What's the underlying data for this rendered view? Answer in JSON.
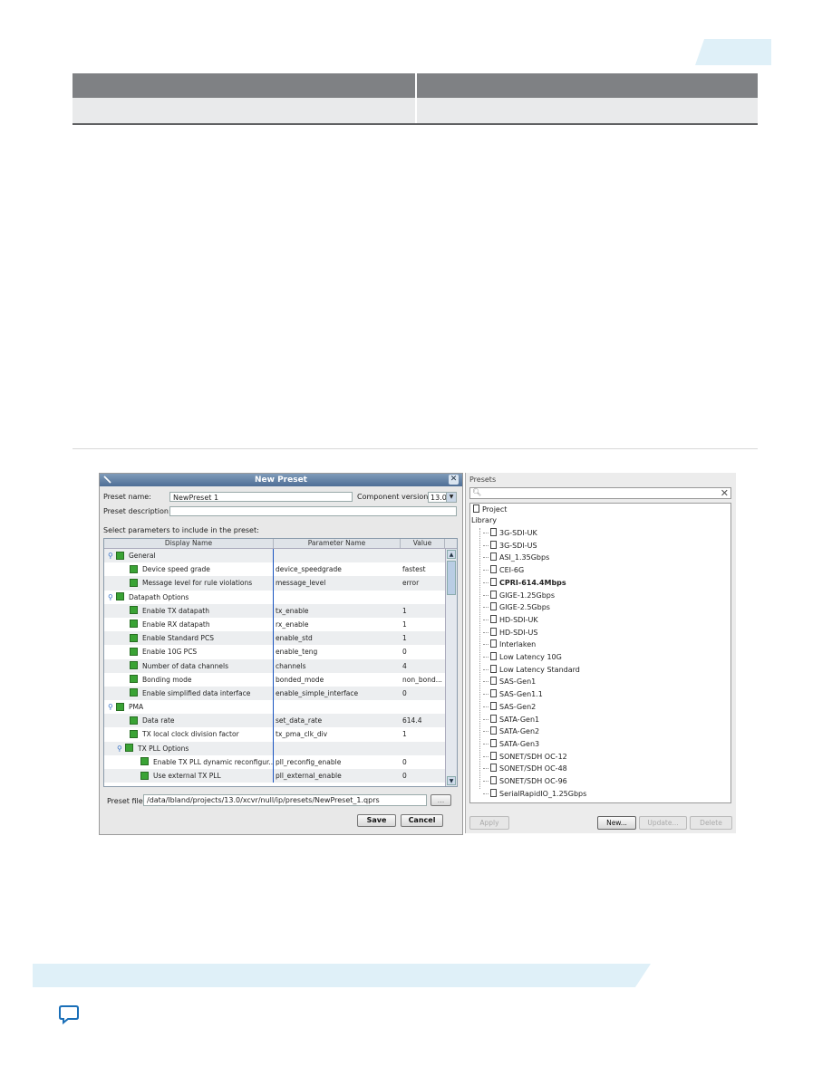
{
  "dialog": {
    "title": "New Preset",
    "close_icon": "close-icon",
    "preset_name_label": "Preset name:",
    "preset_name_value": "NewPreset 1",
    "component_version_label": "Component version:",
    "component_version_value": "13.0",
    "preset_description_label": "Preset description:",
    "preset_description_value": "",
    "select_params_label": "Select parameters to include in the preset:",
    "columns": [
      "Display Name",
      "Parameter Name",
      "Value"
    ],
    "rows": [
      {
        "level": 0,
        "group": true,
        "name": "General",
        "param": "",
        "value": ""
      },
      {
        "level": 1,
        "group": false,
        "name": "Device speed grade",
        "param": "device_speedgrade",
        "value": "fastest"
      },
      {
        "level": 1,
        "group": false,
        "name": "Message level for rule violations",
        "param": "message_level",
        "value": "error"
      },
      {
        "level": 0,
        "group": true,
        "name": "Datapath Options",
        "param": "",
        "value": ""
      },
      {
        "level": 1,
        "group": false,
        "name": "Enable TX datapath",
        "param": "tx_enable",
        "value": "1"
      },
      {
        "level": 1,
        "group": false,
        "name": "Enable RX datapath",
        "param": "rx_enable",
        "value": "1"
      },
      {
        "level": 1,
        "group": false,
        "name": "Enable Standard PCS",
        "param": "enable_std",
        "value": "1"
      },
      {
        "level": 1,
        "group": false,
        "name": "Enable 10G PCS",
        "param": "enable_teng",
        "value": "0"
      },
      {
        "level": 1,
        "group": false,
        "name": "Number of data channels",
        "param": "channels",
        "value": "4"
      },
      {
        "level": 1,
        "group": false,
        "name": "Bonding mode",
        "param": "bonded_mode",
        "value": "non_bond..."
      },
      {
        "level": 1,
        "group": false,
        "name": "Enable simplified data interface",
        "param": "enable_simple_interface",
        "value": "0"
      },
      {
        "level": 0,
        "group": true,
        "name": "PMA",
        "param": "",
        "value": ""
      },
      {
        "level": 1,
        "group": false,
        "name": "Data rate",
        "param": "set_data_rate",
        "value": "614.4"
      },
      {
        "level": 1,
        "group": false,
        "name": "TX local clock division factor",
        "param": "tx_pma_clk_div",
        "value": "1"
      },
      {
        "level": 1,
        "group": true,
        "name": "TX PLL Options",
        "param": "",
        "value": ""
      },
      {
        "level": 2,
        "group": false,
        "name": "Enable TX PLL dynamic reconfigur...",
        "param": "pll_reconfig_enable",
        "value": "0"
      },
      {
        "level": 2,
        "group": false,
        "name": "Use external TX PLL",
        "param": "pll_external_enable",
        "value": "0"
      }
    ],
    "preset_file_label": "Preset file:",
    "preset_file_value": "/data/lbland/projects/13.0/xcvr/null/ip/presets/NewPreset_1.qprs",
    "browse_label": "...",
    "save_label": "Save",
    "cancel_label": "Cancel"
  },
  "presets": {
    "title": "Presets",
    "search_placeholder": "",
    "project_label": "Project",
    "library_label": "Library",
    "items": [
      "3G-SDI-UK",
      "3G-SDI-US",
      "ASI_1.35Gbps",
      "CEI-6G",
      "CPRI-614.4Mbps",
      "GIGE-1.25Gbps",
      "GIGE-2.5Gbps",
      "HD-SDI-UK",
      "HD-SDI-US",
      "Interlaken",
      "Low Latency 10G",
      "Low Latency Standard",
      "SAS-Gen1",
      "SAS-Gen1.1",
      "SAS-Gen2",
      "SATA-Gen1",
      "SATA-Gen2",
      "SATA-Gen3",
      "SONET/SDH OC-12",
      "SONET/SDH OC-48",
      "SONET/SDH OC-96",
      "SerialRapidIO_1.25Gbps"
    ],
    "bold_item": "CPRI-614.4Mbps",
    "apply_label": "Apply",
    "new_label": "New...",
    "update_label": "Update...",
    "delete_label": "Delete"
  },
  "feedback_icon": "feedback-icon"
}
